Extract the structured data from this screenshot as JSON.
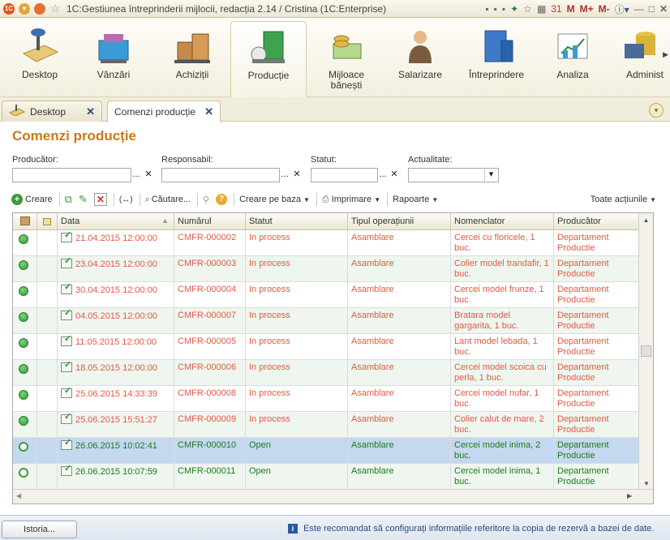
{
  "window": {
    "title": "1C:Gestiunea întreprinderii mijlocii, redacția 2.14 / Cristina  (1C:Enterprise)",
    "buttons": [
      "M",
      "M+",
      "M-"
    ]
  },
  "sections": [
    {
      "label": "Desktop",
      "icon": "desktop-icon"
    },
    {
      "label": "Vânzări",
      "icon": "sales-icon"
    },
    {
      "label": "Achiziții",
      "icon": "purchases-icon"
    },
    {
      "label": "Producție",
      "icon": "production-icon"
    },
    {
      "label": "Mijloace bănești",
      "icon": "money-icon"
    },
    {
      "label": "Salarizare",
      "icon": "payroll-icon"
    },
    {
      "label": "Întreprindere",
      "icon": "enterprise-icon"
    },
    {
      "label": "Analiza",
      "icon": "analysis-icon"
    },
    {
      "label": "Administ",
      "icon": "admin-icon"
    }
  ],
  "tabs": [
    {
      "label": "Desktop"
    },
    {
      "label": "Comenzi producție"
    }
  ],
  "page": {
    "title": "Comenzi producție"
  },
  "filters": {
    "producator": "Producător:",
    "responsabil": "Responsabil:",
    "statut": "Statut:",
    "actualitate": "Actualitate:",
    "dots": "...",
    "clear": "✕"
  },
  "toolbar": {
    "create": "Creare",
    "search": "Căutare...",
    "create_base": "Creare pe baza",
    "print": "Imprimare",
    "reports": "Rapoarte",
    "all_actions": "Toate acțiunile"
  },
  "columns": [
    "Data",
    "Numărul",
    "Statut",
    "Tipul operațiunii",
    "Nomenclator",
    "Producător"
  ],
  "rows": [
    {
      "date": "21.04.2015 12:00:00",
      "number": "CMFR-000002",
      "status": "In process",
      "op": "Asamblare",
      "item": "Cercei cu floricele, 1 buc.",
      "producer": "Departament Productie",
      "state": "in-process"
    },
    {
      "date": "23.04.2015 12:00:00",
      "number": "CMFR-000003",
      "status": "In process",
      "op": "Asamblare",
      "item": "Colier model trandafir, 1 buc.",
      "producer": "Departament Productie",
      "state": "in-process"
    },
    {
      "date": "30.04.2015 12:00:00",
      "number": "CMFR-000004",
      "status": "In process",
      "op": "Asamblare",
      "item": "Cercei model frunze, 1 buc.",
      "producer": "Departament Productie",
      "state": "in-process"
    },
    {
      "date": "04.05.2015 12:00:00",
      "number": "CMFR-000007",
      "status": "In process",
      "op": "Asamblare",
      "item": "Bratara model gargarita, 1 buc.",
      "producer": "Departament Productie",
      "state": "in-process"
    },
    {
      "date": "11.05.2015 12:00:00",
      "number": "CMFR-000005",
      "status": "In process",
      "op": "Asamblare",
      "item": "Lant model lebada, 1 buc.",
      "producer": "Departament Productie",
      "state": "in-process"
    },
    {
      "date": "18.05.2015 12:00:00",
      "number": "CMFR-000006",
      "status": "In process",
      "op": "Asamblare",
      "item": "Cercei model scoica cu perla, 1 buc.",
      "producer": "Departament Productie",
      "state": "in-process"
    },
    {
      "date": "25.06.2015 14:33:39",
      "number": "CMFR-000008",
      "status": "In process",
      "op": "Asamblare",
      "item": "Cercei model nufar, 1 buc.",
      "producer": "Departament Productie",
      "state": "in-process"
    },
    {
      "date": "25.06.2015 15:51:27",
      "number": "CMFR-000009",
      "status": "In process",
      "op": "Asamblare",
      "item": "Colier calut de mare, 2 buc.",
      "producer": "Departament Productie",
      "state": "in-process"
    },
    {
      "date": "26.06.2015 10:02:41",
      "number": "CMFR-000010",
      "status": "Open",
      "op": "Asamblare",
      "item": "Cercei model inima, 2 buc.",
      "producer": "Departament Productie",
      "state": "open"
    },
    {
      "date": "26.06.2015 10:07:59",
      "number": "CMFR-000011",
      "status": "Open",
      "op": "Asamblare",
      "item": "Cercei model inima, 1 buc.",
      "producer": "Departament Productie",
      "state": "open"
    }
  ],
  "footer": {
    "history": "Istoria...",
    "note": "Este recomandat să configurați informațiile referitore la copia de rezervă a bazei de date."
  },
  "colors": {
    "accent": "#c97a14",
    "in_process": "#e15a45",
    "open": "#1a7d1a",
    "selected": "#c4d8f0"
  }
}
